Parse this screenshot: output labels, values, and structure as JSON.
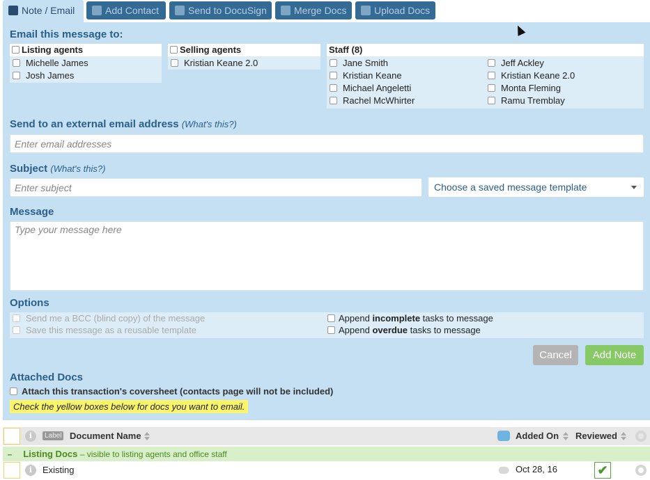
{
  "tabs": [
    {
      "label": "Note / Email",
      "icon": "envelope-icon"
    },
    {
      "label": "Add Contact",
      "icon": "add-contact-icon"
    },
    {
      "label": "Send to DocuSign",
      "icon": "docusign-icon"
    },
    {
      "label": "Merge Docs",
      "icon": "merge-icon"
    },
    {
      "label": "Upload Docs",
      "icon": "upload-icon"
    }
  ],
  "email_to": {
    "heading": "Email this message to:",
    "listing": {
      "header": "Listing agents",
      "items": [
        "Michelle James",
        "Josh James"
      ]
    },
    "selling": {
      "header": "Selling agents",
      "items": [
        "Kristian Keane 2.0"
      ]
    },
    "staff": {
      "header": "Staff (8)",
      "col1": [
        "Jane Smith",
        "Kristian Keane",
        "Michael Angeletti",
        "Rachel McWhirter"
      ],
      "col2": [
        "Jeff Ackley",
        "Kristian Keane 2.0",
        "Monta Fleming",
        "Ramu Tremblay"
      ]
    }
  },
  "external": {
    "label": "Send to an external email address",
    "help": "(What's this?)",
    "placeholder": "Enter email addresses"
  },
  "subject": {
    "label": "Subject",
    "help": "(What's this?)",
    "placeholder": "Enter subject",
    "template_select": "Choose a saved message template"
  },
  "message": {
    "label": "Message",
    "placeholder": "Type your message here"
  },
  "options": {
    "heading": "Options",
    "bcc": "Send me a BCC (blind copy) of the message",
    "save_template": "Save this message as a reusable template",
    "incomplete": {
      "pre": "Append ",
      "bold": "incomplete",
      "post": " tasks to message"
    },
    "overdue": {
      "pre": "Append ",
      "bold": "overdue",
      "post": " tasks to message"
    }
  },
  "buttons": {
    "cancel": "Cancel",
    "add_note": "Add Note"
  },
  "attached": {
    "heading": "Attached Docs",
    "coversheet": "Attach this transaction's coversheet (contacts page will not be included)",
    "hint": "Check the yellow boxes below for docs you want to email."
  },
  "table": {
    "label_badge": "Label",
    "col_name": "Document Name",
    "col_added": "Added On",
    "col_reviewed": "Reviewed",
    "group": {
      "name": "Listing Docs",
      "note": "– visible to listing agents and office staff"
    },
    "rows": [
      {
        "name": "Existing",
        "added": "Oct 28, 16",
        "reviewed": true
      }
    ]
  },
  "colors": {
    "panel": "#c5e0f2",
    "heading": "#2b5f8a",
    "add_note": "#86c965",
    "cancel": "#b4b4b4"
  }
}
